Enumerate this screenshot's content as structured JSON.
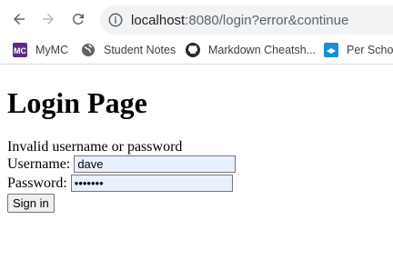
{
  "browser": {
    "url_host": "localhost",
    "url_rest": ":8080/login?error&continue",
    "bookmarks": [
      {
        "label": "MyMC",
        "icon": "mymc-logo-icon"
      },
      {
        "label": "Student Notes",
        "icon": "globe-icon"
      },
      {
        "label": "Markdown Cheatsh...",
        "icon": "github-icon"
      },
      {
        "label": "Per Schola",
        "icon": "bookmark-favicon-icon"
      }
    ]
  },
  "page": {
    "title": "Login Page",
    "error_message": "Invalid username or password",
    "username_label": "Username:",
    "username_value": "dave",
    "password_label": "Password:",
    "password_value": "•••••••",
    "submit_label": "Sign in"
  }
}
